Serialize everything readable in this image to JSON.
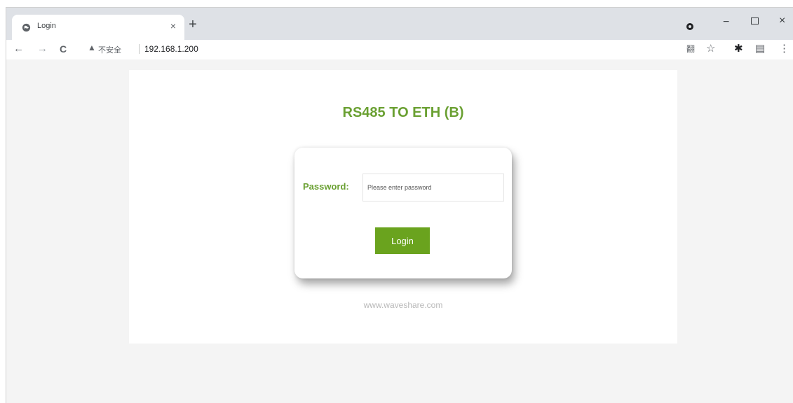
{
  "browser": {
    "tab": {
      "title": "Login",
      "close_glyph": "×",
      "favicon": "globe-icon"
    },
    "new_tab_glyph": "+",
    "window_controls": {
      "minimize": "−",
      "close": "×"
    },
    "nav": {
      "back": "←",
      "forward": "→",
      "reload": "C"
    },
    "address": {
      "security_label": "不安全",
      "url": "192.168.1.200"
    },
    "toolbar_icons": {
      "translate": "翻",
      "bookmark": "☆",
      "extensions": "✱",
      "reading": "▤",
      "menu": "⋮"
    }
  },
  "page": {
    "heading": "RS485 TO ETH (B)",
    "password_label": "Password:",
    "password_placeholder": "Please enter password",
    "login_label": "Login",
    "footer_link": "www.waveshare.com"
  },
  "colors": {
    "accent_green": "#6aa032",
    "button_green": "#6aa31e",
    "page_bg": "#f4f4f4"
  }
}
